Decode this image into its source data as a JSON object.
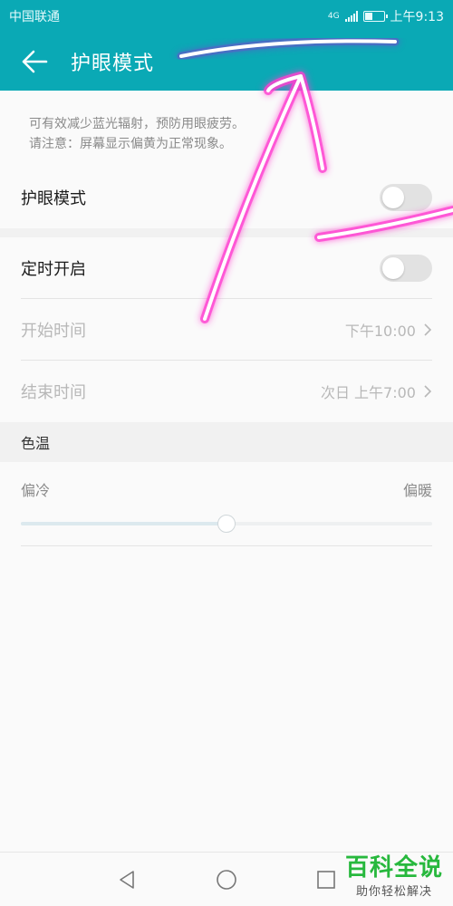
{
  "status_bar": {
    "carrier": "中国联通",
    "network": "4G",
    "time": "上午9:13"
  },
  "app_bar": {
    "title": "护眼模式"
  },
  "description": {
    "line1": "可有效减少蓝光辐射，预防用眼疲劳。",
    "line2": "请注意：屏幕显示偏黄为正常现象。"
  },
  "settings": {
    "eye_mode_label": "护眼模式",
    "eye_mode_on": false,
    "schedule_label": "定时开启",
    "schedule_on": false,
    "start_time_label": "开始时间",
    "start_time_value": "下午10:00",
    "end_time_label": "结束时间",
    "end_time_value": "次日 上午7:00"
  },
  "color_temperature": {
    "header": "色温",
    "cool_label": "偏冷",
    "warm_label": "偏暖",
    "value_fraction": 0.5
  },
  "watermark": {
    "title": "百科全说",
    "subtitle": "助你轻松解决"
  },
  "colors": {
    "accent": "#0aa9b5",
    "annotation": "#ff3fd0"
  }
}
